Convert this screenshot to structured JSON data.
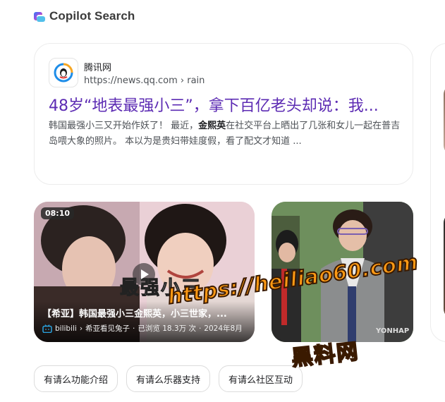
{
  "header": {
    "title": "Copilot Search",
    "logo_icon": "copilot-logo-icon"
  },
  "result": {
    "site_name": "腾讯网",
    "url": "https://news.qq.com › rain",
    "title": "48岁“地表最强小三”，拿下百亿老头却说：我...",
    "snippet_pre": "韩国最强小三又开始作妖了！ 最近，",
    "snippet_bold": "金熙英",
    "snippet_post": "在社交平台上晒出了几张和女儿一起在普吉岛喂大象的照片。 本以为是贵妇带娃度假，看了配文才知道 ...",
    "title_color": "#5c2bb3"
  },
  "video": {
    "duration": "08:10",
    "overlay_text": "最强小三",
    "title": "【希亚】韩国最强小三金熙英，小三世家，...",
    "source": "bilibili",
    "channel": "希亚看见兔子",
    "views": "已浏览 18.3万 次",
    "date": "2024年8月"
  },
  "image": {
    "watermark": "YONHAP"
  },
  "chips": [
    "有请么功能介绍",
    "有请么乐器支持",
    "有请么社区互动"
  ],
  "overlay_watermark": {
    "url": "https://heiliao60.com",
    "name": "黑料网",
    "color": "#ff9a14"
  }
}
